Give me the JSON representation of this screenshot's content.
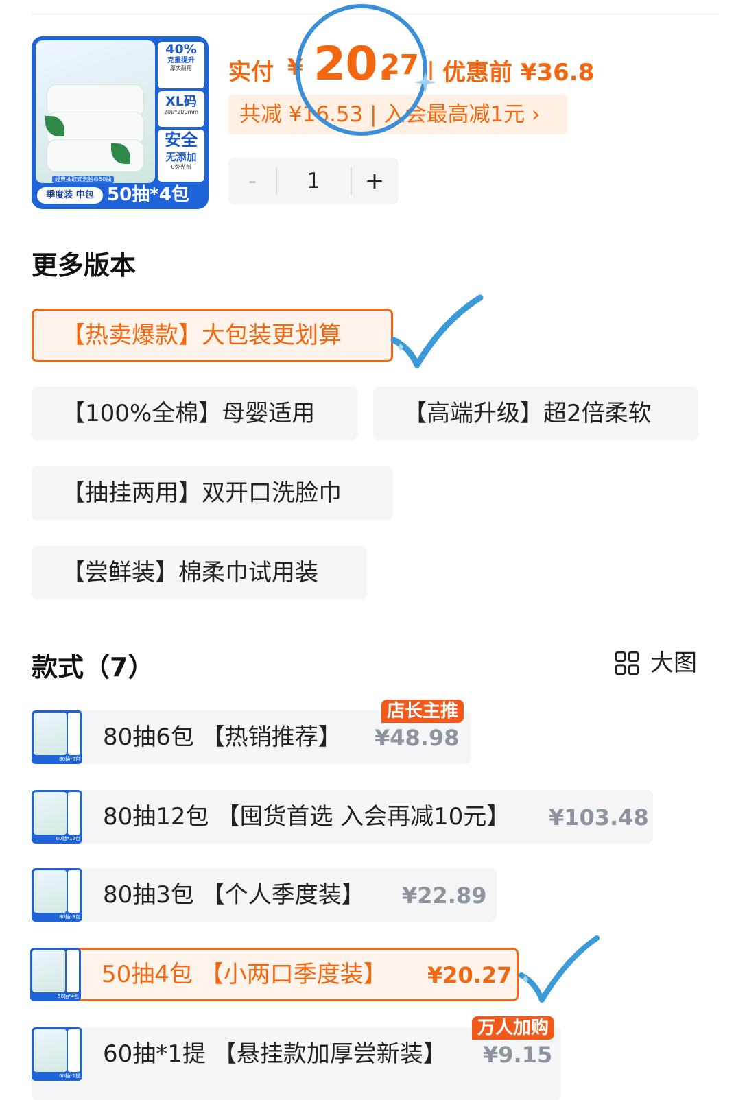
{
  "product": {
    "thumb": {
      "side_top_big": "40%",
      "side_top_small": "克重提升",
      "side_top_tiny": "厚实耐用",
      "side_mid_big": "XL码",
      "side_mid_tiny": "200*200mm",
      "side_bottom_big": "安全",
      "side_bottom_small": "无添加",
      "side_bottom_tiny": "0荧光剂",
      "caption": "经典抽取式洗脸巾50抽",
      "tag": "季度装 中包",
      "big_text": "50抽*4包"
    },
    "price_label": "实付",
    "price_yen": "¥",
    "price_int": "20.",
    "price_dec": "27",
    "price_separator": "|",
    "price_before": "优惠前 ¥36.8",
    "discount_text": "共减 ¥16.53 | 入会最高减1元 ›",
    "quantity": {
      "minus": "-",
      "value": "1",
      "plus": "+"
    }
  },
  "versions": {
    "title": "更多版本",
    "items": [
      {
        "label": "【热卖爆款】大包装更划算",
        "selected": true
      },
      {
        "label": "【100%全棉】母婴适用",
        "selected": false
      },
      {
        "label": "【高端升级】超2倍柔软",
        "selected": false
      },
      {
        "label": "【抽挂两用】双开口洗脸巾",
        "selected": false
      },
      {
        "label": "【尝鲜装】棉柔巾试用装",
        "selected": false
      }
    ]
  },
  "styles": {
    "title": "款式（7）",
    "big_pic_label": "大图",
    "items": [
      {
        "thumb_text": "80抽*6包",
        "name": "80抽6包 【热销推荐】",
        "price": "¥48.98",
        "badge": "店长主推",
        "selected": false
      },
      {
        "thumb_text": "80抽*12包",
        "name": "80抽12包 【囤货首选 入会再减10元】",
        "price": "¥103.48",
        "badge": "",
        "selected": false
      },
      {
        "thumb_text": "80抽*3包",
        "name": "80抽3包 【个人季度装】",
        "price": "¥22.89",
        "badge": "",
        "selected": false
      },
      {
        "thumb_text": "50抽*4包",
        "name": "50抽4包 【小两口季度装】",
        "price": "¥20.27",
        "badge": "",
        "selected": true
      },
      {
        "thumb_text": "60抽*1提",
        "name": "60抽*1提 【悬挂款加厚尝新装】",
        "price": "¥9.15",
        "badge": "万人加购",
        "selected": false
      }
    ]
  },
  "colors": {
    "accent": "#f2670f",
    "annotation": "#3b8fd8",
    "chip_bg": "#f4f5f7",
    "badge": "#f25a1c"
  }
}
